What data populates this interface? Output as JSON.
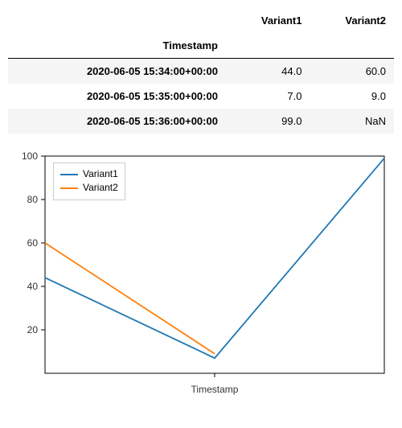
{
  "table": {
    "index_name": "Timestamp",
    "columns": [
      "Variant1",
      "Variant2"
    ],
    "rows": [
      {
        "timestamp": "2020-06-05 15:34:00+00:00",
        "variant1": "44.0",
        "variant2": "60.0"
      },
      {
        "timestamp": "2020-06-05 15:35:00+00:00",
        "variant1": "7.0",
        "variant2": "9.0"
      },
      {
        "timestamp": "2020-06-05 15:36:00+00:00",
        "variant1": "99.0",
        "variant2": "NaN"
      }
    ]
  },
  "chart_data": {
    "type": "line",
    "xlabel": "Timestamp",
    "ylabel": "",
    "ylim": [
      0,
      100
    ],
    "yticks": [
      20,
      40,
      60,
      80,
      100
    ],
    "x_index": [
      0,
      1,
      2
    ],
    "x_categories": [
      "2020-06-05 15:34:00+00:00",
      "2020-06-05 15:35:00+00:00",
      "2020-06-05 15:36:00+00:00"
    ],
    "series": [
      {
        "name": "Variant1",
        "values": [
          44,
          7,
          99
        ],
        "color": "#1f77b4"
      },
      {
        "name": "Variant2",
        "values": [
          60,
          9,
          null
        ],
        "color": "#ff7f0e"
      }
    ],
    "legend_position": "upper-left"
  },
  "colors": {
    "variant1": "#1f77b4",
    "variant2": "#ff7f0e"
  }
}
